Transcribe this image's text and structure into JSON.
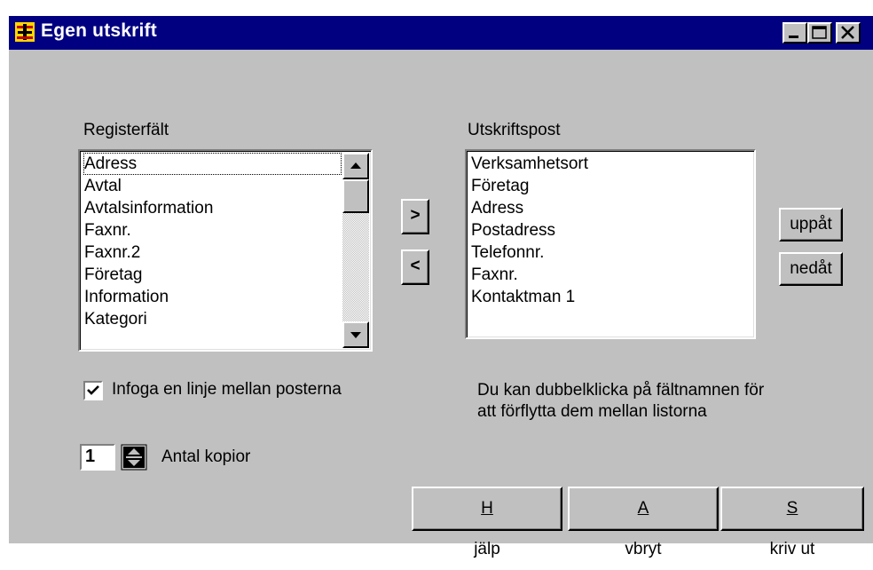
{
  "window": {
    "title": "Egen utskrift"
  },
  "titlebar": {
    "minimize_icon": "minimize-icon",
    "maximize_icon": "maximize-icon",
    "close_icon": "close-icon"
  },
  "left_list": {
    "label": "Registerfält",
    "items": [
      "Adress",
      "Avtal",
      "Avtalsinformation",
      "Faxnr.",
      "Faxnr.2",
      "Företag",
      "Information",
      "Kategori"
    ],
    "focused_index": 0
  },
  "right_list": {
    "label": "Utskriftspost",
    "items": [
      "Verksamhetsort",
      "Företag",
      "Adress",
      "Postadress",
      "Telefonnr.",
      "Faxnr.",
      "Kontaktman 1"
    ]
  },
  "transfer": {
    "add_label": ">",
    "remove_label": "<"
  },
  "order": {
    "up_label": "uppåt",
    "down_label": "nedåt"
  },
  "checkbox": {
    "label": "Infoga en linje mellan posterna",
    "checked": true
  },
  "copies": {
    "value": "1",
    "label": "Antal kopior"
  },
  "hint": {
    "line1": "Du kan dubbelklicka på fältnamnen för",
    "line2": "att förflytta dem mellan listorna"
  },
  "buttons": {
    "help": {
      "mnemonic": "H",
      "rest": "jälp"
    },
    "cancel": {
      "mnemonic": "A",
      "rest": "vbryt"
    },
    "print": {
      "mnemonic": "S",
      "rest": "kriv ut"
    }
  },
  "colors": {
    "titlebar": "#000080",
    "face": "#c0c0c0",
    "window": "#ffffff"
  }
}
